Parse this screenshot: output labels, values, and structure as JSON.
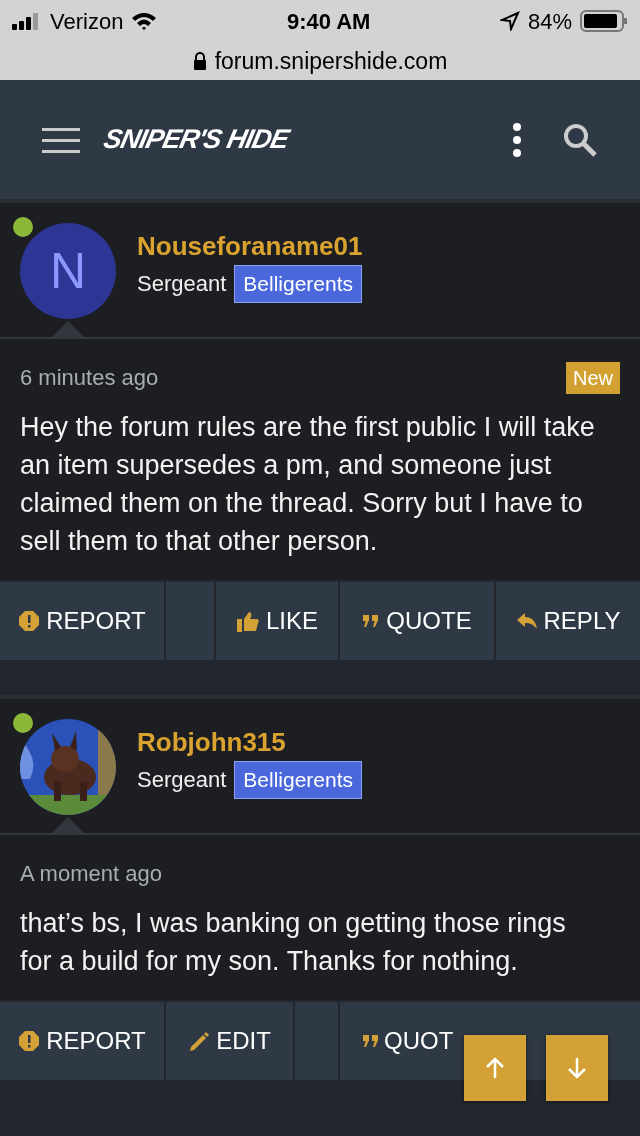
{
  "status_bar": {
    "carrier": "Verizon",
    "time": "9:40 AM",
    "battery": "84%"
  },
  "address_bar": {
    "url": "forum.snipershide.com"
  },
  "header": {
    "logo": "SNIPER'S HIDE"
  },
  "posts": [
    {
      "avatar": {
        "kind": "letter",
        "letter": "N"
      },
      "online": true,
      "username": "Nouseforaname01",
      "rank": "Sergeant",
      "group": "Belligerents",
      "time": "6 minutes ago",
      "is_new": true,
      "new_label": "New",
      "body": "Hey the forum rules are the first public I will take an item supersedes a pm, and someone just claimed them on the thread. Sorry but I have to sell them to that other person.",
      "actions": [
        {
          "kind": "report",
          "label": "REPORT"
        },
        {
          "kind": "spacer"
        },
        {
          "kind": "like",
          "label": "LIKE"
        },
        {
          "kind": "quote",
          "label": "QUOTE"
        },
        {
          "kind": "reply",
          "label": "REPLY"
        }
      ]
    },
    {
      "online": true,
      "username": "Robjohn315",
      "rank": "Sergeant",
      "group": "Belligerents",
      "time": "A moment ago",
      "is_new": false,
      "body": "that’s bs, I was banking on getting those rings for a build for my son. Thanks for nothing.",
      "actions": [
        {
          "kind": "report",
          "label": "REPORT"
        },
        {
          "kind": "edit",
          "label": "EDIT"
        },
        {
          "kind": "spacer"
        },
        {
          "kind": "quote",
          "label": "QUOT"
        },
        {
          "kind": "spacer"
        }
      ]
    }
  ]
}
